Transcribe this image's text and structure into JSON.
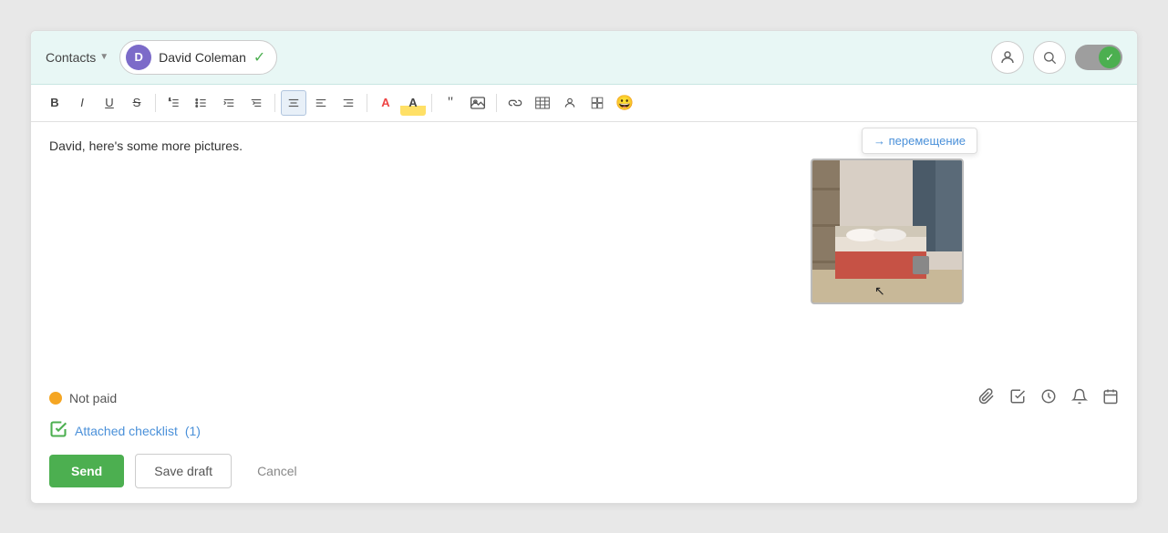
{
  "header": {
    "contacts_label": "Contacts",
    "recipient_initial": "D",
    "recipient_name": "David Coleman",
    "avatar_bg": "#7c6bc9"
  },
  "toolbar": {
    "buttons": [
      {
        "label": "B",
        "name": "bold",
        "class": "bold"
      },
      {
        "label": "I",
        "name": "italic",
        "class": "italic"
      },
      {
        "label": "U",
        "name": "underline",
        "class": "underline"
      },
      {
        "label": "S̶",
        "name": "strikethrough",
        "class": "strike"
      },
      {
        "label": "≡1",
        "name": "ordered-list"
      },
      {
        "label": "≡•",
        "name": "unordered-list"
      },
      {
        "label": "⊟",
        "name": "outdent"
      },
      {
        "label": "⊞",
        "name": "indent"
      },
      {
        "label": "≡",
        "name": "align-center",
        "active": true
      },
      {
        "label": "≡",
        "name": "align-left"
      },
      {
        "label": "≡",
        "name": "align-right"
      },
      {
        "label": "A▼",
        "name": "font-color"
      },
      {
        "label": "A▼",
        "name": "bg-color"
      },
      {
        "label": "❝",
        "name": "blockquote"
      },
      {
        "label": "⊡",
        "name": "insert-image"
      },
      {
        "label": "🔗",
        "name": "link"
      },
      {
        "label": "📋",
        "name": "table"
      },
      {
        "label": "👤",
        "name": "contact"
      },
      {
        "label": "⊞",
        "name": "widget"
      },
      {
        "label": "😀",
        "name": "emoji"
      }
    ]
  },
  "editor": {
    "body_text": "David, here's some more pictures."
  },
  "status": {
    "label": "Not paid"
  },
  "checklist": {
    "link_label": "Attached checklist",
    "count": "(1)"
  },
  "tooltip": {
    "arrow": "→",
    "text": "перемещение"
  },
  "buttons": {
    "send": "Send",
    "save_draft": "Save draft",
    "cancel": "Cancel"
  },
  "action_icons": {
    "paperclip": "📎",
    "checklist": "☑",
    "clock": "🕐",
    "bell": "🔔",
    "calendar": "📅"
  }
}
